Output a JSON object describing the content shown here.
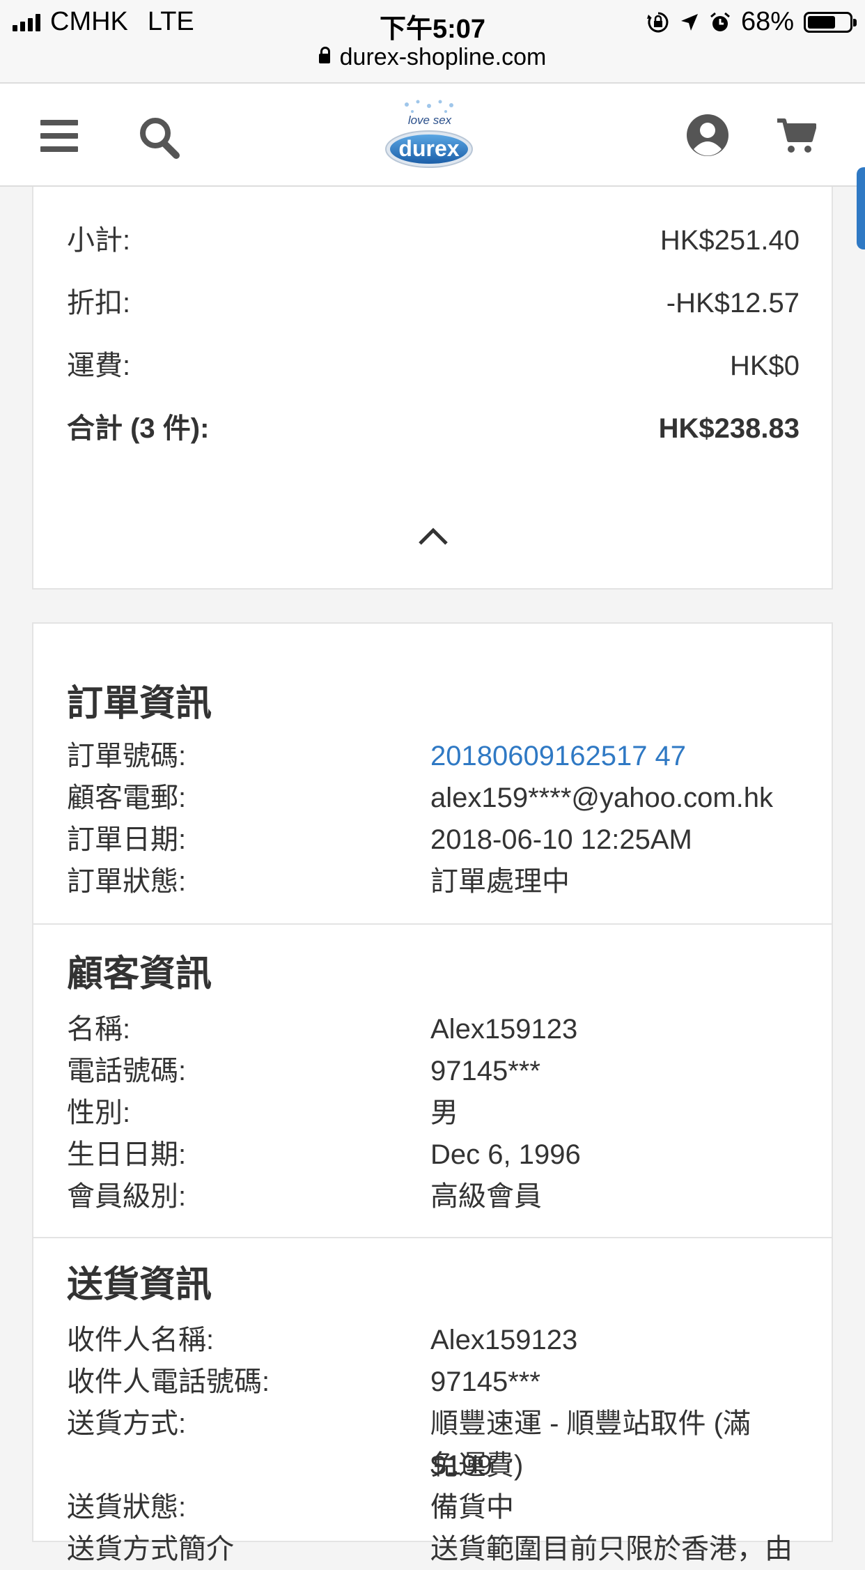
{
  "status_bar": {
    "carrier": "CMHK",
    "network": "LTE",
    "time": "下午5:07",
    "battery": "68%",
    "battery_level": 0.68
  },
  "browser": {
    "url": "durex-shopline.com"
  },
  "header": {
    "logo_tagline": "love sex",
    "logo_brand": "durex",
    "icons": [
      "menu-icon",
      "search-icon",
      "user-icon",
      "cart-icon"
    ]
  },
  "summary": {
    "rows": [
      {
        "label": "小計:",
        "value": "HK$251.40"
      },
      {
        "label": "折扣:",
        "value": "-HK$12.57"
      },
      {
        "label": "運費:",
        "value": "HK$0"
      },
      {
        "label": "合計 (3 件):",
        "value": "HK$238.83"
      }
    ]
  },
  "order_info": {
    "title": "訂單資訊",
    "rows": [
      {
        "label": "訂單號碼:",
        "value": "20180609162517 47"
      },
      {
        "label": "顧客電郵:",
        "value": "alex159****@yahoo.com.hk"
      },
      {
        "label": "訂單日期:",
        "value": "2018-06-10 12:25AM"
      },
      {
        "label": "訂單狀態:",
        "value": "訂單處理中"
      }
    ]
  },
  "customer_info": {
    "title": "顧客資訊",
    "rows": [
      {
        "label": "名稱:",
        "value": "Alex159123"
      },
      {
        "label": "電話號碼:",
        "value": "97145***"
      },
      {
        "label": "性別:",
        "value": "男"
      },
      {
        "label": "生日日期:",
        "value": "Dec 6, 1996"
      },
      {
        "label": "會員級別:",
        "value": "高級會員"
      }
    ]
  },
  "delivery_info": {
    "title": "送貨資訊",
    "rows": [
      {
        "label": "收件人名稱:",
        "value": "Alex159123"
      },
      {
        "label": "收件人電話號碼:",
        "value": "97145***"
      },
      {
        "label": "送貨方式:",
        "value": "順豐速運 - 順豐站取件 (滿$199",
        "value2": "免運費)"
      },
      {
        "label": "送貨狀態:",
        "value": "備貨中"
      },
      {
        "label": "送貨方式簡介",
        "value": "送貨範圍目前只限於香港，由"
      }
    ]
  },
  "colors": {
    "link": "#2f79c4",
    "accent": "#2f79c4",
    "icon": "#555555"
  }
}
